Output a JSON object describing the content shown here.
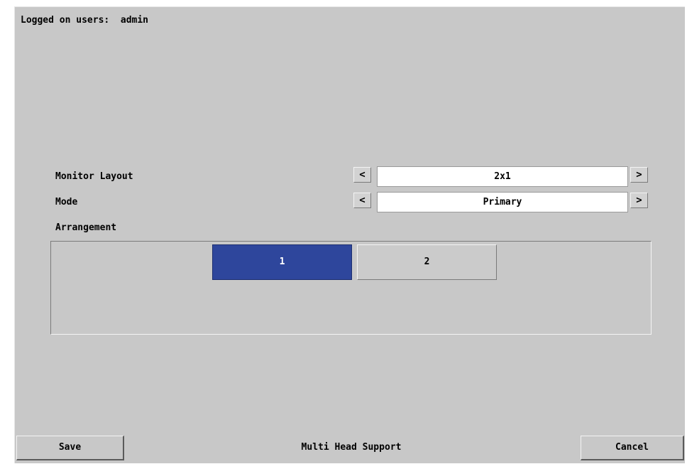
{
  "status": {
    "text": "Logged on users:  admin"
  },
  "settings": {
    "monitor_layout": {
      "label": "Monitor Layout",
      "value": "2x1",
      "prev_glyph": "<",
      "next_glyph": ">"
    },
    "mode": {
      "label": "Mode",
      "value": "Primary",
      "prev_glyph": "<",
      "next_glyph": ">"
    },
    "arrangement": {
      "label": "Arrangement",
      "monitors": [
        {
          "label": "1",
          "selected": true
        },
        {
          "label": "2",
          "selected": false
        }
      ]
    }
  },
  "footer": {
    "save_label": "Save",
    "title": "Multi Head Support",
    "cancel_label": "Cancel"
  },
  "colors": {
    "background": "#c8c8c8",
    "selected_monitor": "#2e469c",
    "field_background": "#ffffff"
  }
}
